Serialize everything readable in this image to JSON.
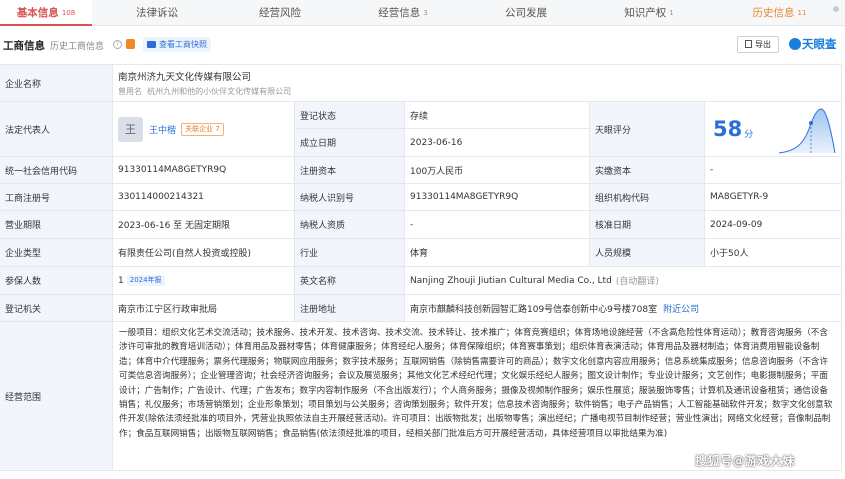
{
  "tabs": [
    {
      "label": "基本信息",
      "count": "108"
    },
    {
      "label": "法律诉讼",
      "count": ""
    },
    {
      "label": "经营风险",
      "count": ""
    },
    {
      "label": "经营信息",
      "count": "3"
    },
    {
      "label": "公司发展",
      "count": ""
    },
    {
      "label": "知识产权",
      "count": "1"
    },
    {
      "label": "历史信息",
      "count": "11"
    }
  ],
  "history_tab_badge": "",
  "section": {
    "title": "工商信息",
    "history_link": "历史工商信息",
    "history_count": "",
    "snapshot_button": "查看工商快照",
    "export_button": "导出",
    "brand": "天眼查"
  },
  "labels": {
    "company_name": "企业名称",
    "legal_rep": "法定代表人",
    "reg_status": "登记状态",
    "established": "成立日期",
    "tianyan_score": "天眼评分",
    "credit_code": "统一社会信用代码",
    "reg_capital": "注册资本",
    "paid_capital": "实缴资本",
    "reg_number": "工商注册号",
    "taxpayer_id": "纳税人识别号",
    "org_code": "组织机构代码",
    "business_term": "营业期限",
    "taxpayer_qual": "纳税人资质",
    "approval_date": "核准日期",
    "company_type": "企业类型",
    "industry": "行业",
    "staff_size": "人员规模",
    "insured": "参保人数",
    "english_name": "英文名称",
    "reg_authority": "登记机关",
    "reg_address": "注册地址",
    "scope": "经营范围"
  },
  "values": {
    "company_name": "南京州济九天文化传媒有限公司",
    "former_name_label": "曾用名",
    "former_name": "杭州九州和他的小伙伴文化传媒有限公司",
    "legal_rep_avatar": "王",
    "legal_rep_name": "王中楷",
    "legal_rep_related": "关联企业 7",
    "reg_status": "存续",
    "established": "2023-06-16",
    "score": "58",
    "score_unit": "分",
    "credit_code": "91330114MA8GETYR9Q",
    "reg_capital": "100万人民币",
    "paid_capital": "-",
    "reg_number": "330114000214321",
    "taxpayer_id": "91330114MA8GETYR9Q",
    "org_code": "MA8GETYR-9",
    "business_term": "2023-06-16 至 无固定期限",
    "taxpayer_qual": "-",
    "approval_date": "2024-09-09",
    "company_type": "有限责任公司(自然人投资或控股)",
    "industry": "体育",
    "staff_size": "小于50人",
    "insured": "1",
    "insured_report": "2024年报",
    "english_name": "Nanjing Zhouji Jiutian Cultural Media Co., Ltd",
    "english_auto": "(自动翻译)",
    "reg_authority": "南京市江宁区行政审批局",
    "reg_address": "南京市麒麟科技创新园智汇路109号信泰创新中心9号楼708室",
    "nearby": "附近公司",
    "scope": "一般项目：组织文化艺术交流活动；技术服务、技术开发、技术咨询、技术交流、技术转让、技术推广；体育竞赛组织；体育场地设施经营（不含高危险性体育运动）；教育咨询服务（不含涉许可审批的教育培训活动）；体育用品及器材零售；体育健康服务；体育经纪人服务；体育保障组织；体育赛事策划；组织体育表演活动；体育用品及器材制造；体育消费用智能设备制造；体育中介代理服务；票务代理服务；物联网应用服务；数字技术服务；互联网销售（除销售需要许可的商品）；数字文化创意内容应用服务；信息系统集成服务；信息咨询服务（不含许可类信息咨询服务）；企业管理咨询；社会经济咨询服务；会议及展览服务；其他文化艺术经纪代理；文化娱乐经纪人服务；图文设计制作；专业设计服务；文艺创作；电影摄制服务；平面设计；广告制作；广告设计、代理；广告发布；数字内容制作服务（不含出版发行）；个人商务服务；摄像及视频制作服务；娱乐性展览；服装服饰零售；计算机及通讯设备租赁；通信设备销售；礼仪服务；市场营销策划；企业形象策划；项目策划与公关服务；咨询策划服务；软件开发；信息技术咨询服务；软件销售；电子产品销售；人工智能基础软件开发；数字文化创意软件开发(除依法须经批准的项目外，凭营业执照依法自主开展经营活动)。许可项目：出版物批发；出版物零售；演出经纪；广播电视节目制作经营；营业性演出；网络文化经营；音像制品制作；食品互联网销售；出版物互联网销售；食品销售(依法须经批准的项目，经相关部门批准后方可开展经营活动，具体经营项目以审批结果为准)"
  },
  "watermark": "搜狐号@游戏大妹",
  "colors": {
    "accent": "#d9534f",
    "blue": "#2b6fd6",
    "green": "#2fa65d",
    "label_bg": "#f2f6fc"
  }
}
